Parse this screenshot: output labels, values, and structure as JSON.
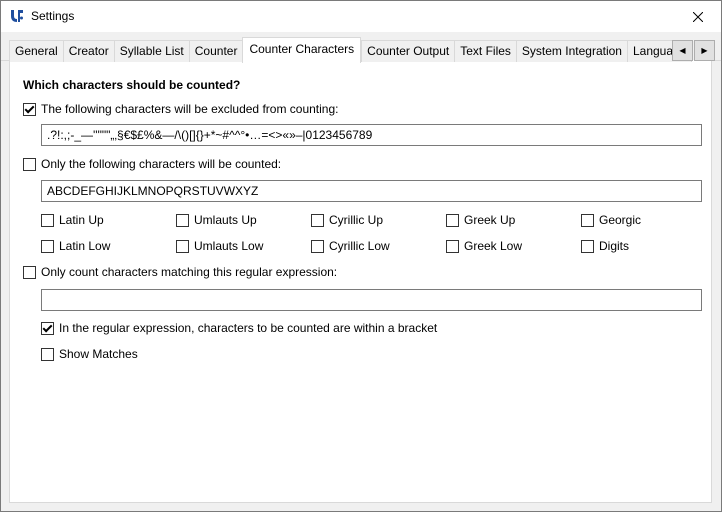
{
  "window": {
    "title": "Settings"
  },
  "tabs": [
    {
      "label": "General"
    },
    {
      "label": "Creator"
    },
    {
      "label": "Syllable List"
    },
    {
      "label": "Counter"
    },
    {
      "label": "Counter Characters"
    },
    {
      "label": "Counter Output"
    },
    {
      "label": "Text Files"
    },
    {
      "label": "System Integration"
    },
    {
      "label": "Language"
    }
  ],
  "active_tab": "Counter Characters",
  "section": {
    "heading": "Which characters should be counted?"
  },
  "exclude": {
    "label": "The following characters will be excluded from counting:",
    "checked": true,
    "value": ".?!:,;-_—''\"\"\"„‚§€$£%&—/\\()[]{}+*~#^^°•…=<>«»–|0123456789"
  },
  "only": {
    "label": "Only the following characters will be counted:",
    "checked": false,
    "value": "ABCDEFGHIJKLMNOPQRSTUVWXYZ"
  },
  "charsets": [
    {
      "label": "Latin Up",
      "checked": false
    },
    {
      "label": "Umlauts Up",
      "checked": false
    },
    {
      "label": "Cyrillic Up",
      "checked": false
    },
    {
      "label": "Greek Up",
      "checked": false
    },
    {
      "label": "Georgic",
      "checked": false
    },
    {
      "label": "Latin Low",
      "checked": false
    },
    {
      "label": "Umlauts Low",
      "checked": false
    },
    {
      "label": "Cyrillic Low",
      "checked": false
    },
    {
      "label": "Greek Low",
      "checked": false
    },
    {
      "label": "Digits",
      "checked": false
    }
  ],
  "regex": {
    "label": "Only count characters matching this regular expression:",
    "checked": false,
    "value": ""
  },
  "bracket": {
    "label": "In the regular expression, characters to be counted are within a bracket",
    "checked": true
  },
  "show_matches": {
    "label": "Show Matches",
    "checked": false
  },
  "colors": {
    "border": "#7a7a7a",
    "tab_bg": "#f0f0f0",
    "panel_bg": "#ffffff"
  }
}
